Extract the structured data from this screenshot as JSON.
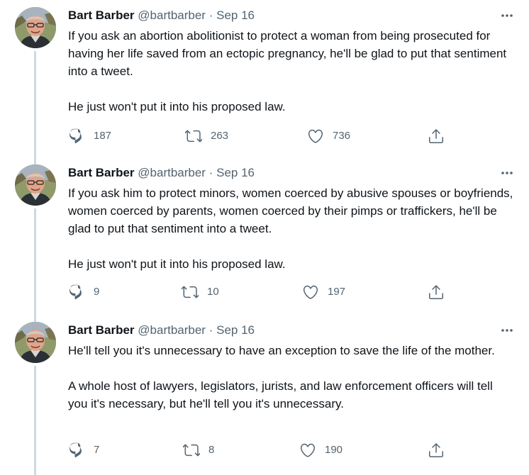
{
  "colors": {
    "text": "#0f1419",
    "secondary": "#536471",
    "thread_line": "#cfd9de"
  },
  "icons": {
    "reply": "reply-icon",
    "retweet": "retweet-icon",
    "like": "heart-icon",
    "share": "share-icon",
    "more": "more-icon"
  },
  "tweets": [
    {
      "author_name": "Bart Barber",
      "handle": "@bartbarber",
      "separator": "·",
      "date": "Sep 16",
      "paragraphs": [
        "If you ask an abortion abolitionist to protect a woman from being prosecuted for having her life saved from an ectopic pregnancy, he'll be glad to put that sentiment into a tweet.",
        "He just won't put it into his proposed law."
      ],
      "replies": "187",
      "retweets": "263",
      "likes": "736"
    },
    {
      "author_name": "Bart Barber",
      "handle": "@bartbarber",
      "separator": "·",
      "date": "Sep 16",
      "paragraphs": [
        "If you ask him to protect minors, women coerced by abusive spouses or boyfriends, women coerced by parents, women coerced by their pimps or traffickers, he'll be glad to put that sentiment into a tweet.",
        "He just won't put it into his proposed law."
      ],
      "replies": "9",
      "retweets": "10",
      "likes": "197"
    },
    {
      "author_name": "Bart Barber",
      "handle": "@bartbarber",
      "separator": "·",
      "date": "Sep 16",
      "paragraphs": [
        "He'll tell you it's unnecessary to have an exception to save the life of the mother.",
        "A whole host of lawyers, legislators, jurists, and law enforcement officers will tell you it's necessary, but he'll tell you it's unnecessary."
      ],
      "replies": "7",
      "retweets": "8",
      "likes": "190"
    }
  ]
}
